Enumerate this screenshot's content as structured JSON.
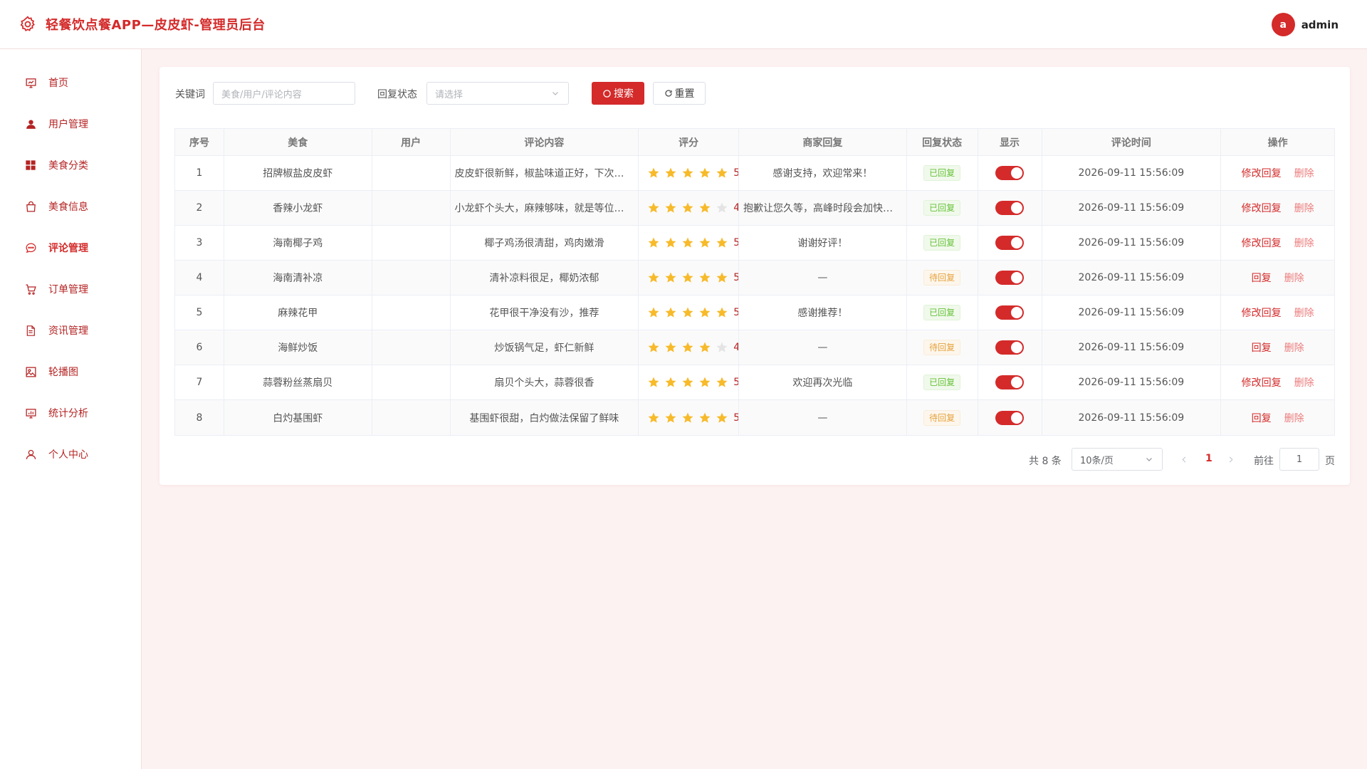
{
  "header": {
    "app_title": "轻餐饮点餐APP—皮皮虾-管理员后台",
    "avatar_letter": "a",
    "username": "admin",
    "accent_color": "#d42a2a"
  },
  "sidebar": {
    "items": [
      {
        "label": "首页",
        "icon": "dashboard-chart-icon"
      },
      {
        "label": "用户管理",
        "icon": "user-icon"
      },
      {
        "label": "美食分类",
        "icon": "grid-icon"
      },
      {
        "label": "美食信息",
        "icon": "shopping-bag-icon"
      },
      {
        "label": "评论管理",
        "icon": "chat-bubble-icon",
        "active": true
      },
      {
        "label": "订单管理",
        "icon": "cart-icon"
      },
      {
        "label": "资讯管理",
        "icon": "document-icon"
      },
      {
        "label": "轮播图",
        "icon": "image-icon"
      },
      {
        "label": "统计分析",
        "icon": "chart-icon"
      },
      {
        "label": "个人中心",
        "icon": "user-outline-icon"
      }
    ]
  },
  "filters": {
    "keyword_label": "关键词",
    "keyword_placeholder": "美食/用户/评论内容",
    "status_label": "回复状态",
    "status_placeholder": "请选择",
    "search_label": "搜索",
    "reset_label": "重置"
  },
  "table": {
    "headers": [
      "序号",
      "美食",
      "用户",
      "评论内容",
      "评分",
      "商家回复",
      "回复状态",
      "显示",
      "评论时间",
      "操作"
    ],
    "rows": [
      {
        "no": "1",
        "food": "招牌椒盐皮皮虾",
        "user": "",
        "comment": "皮皮虾很新鲜，椒盐味道正好，下次还来",
        "rating": 5,
        "rating_text": "5",
        "reply": "感谢支持，欢迎常来！",
        "status": "已回复",
        "replied": true,
        "visible": true,
        "time": "2026-09-11 15:56:09",
        "op_reply": "修改回复",
        "op_delete": "删除"
      },
      {
        "no": "2",
        "food": "香辣小龙虾",
        "user": "",
        "comment": "小龙虾个头大，麻辣够味，就是等位时间久",
        "rating": 4,
        "rating_text": "4",
        "reply": "抱歉让您久等，高峰时段会加快出餐",
        "status": "已回复",
        "replied": true,
        "visible": true,
        "time": "2026-09-11 15:56:09",
        "op_reply": "修改回复",
        "op_delete": "删除"
      },
      {
        "no": "3",
        "food": "海南椰子鸡",
        "user": "",
        "comment": "椰子鸡汤很清甜，鸡肉嫩滑",
        "rating": 5,
        "rating_text": "5",
        "reply": "谢谢好评！",
        "status": "已回复",
        "replied": true,
        "visible": true,
        "time": "2026-09-11 15:56:09",
        "op_reply": "修改回复",
        "op_delete": "删除"
      },
      {
        "no": "4",
        "food": "海南清补凉",
        "user": "",
        "comment": "清补凉料很足，椰奶浓郁",
        "rating": 5,
        "rating_text": "5",
        "reply": "—",
        "status": "待回复",
        "replied": false,
        "visible": true,
        "time": "2026-09-11 15:56:09",
        "op_reply": "回复",
        "op_delete": "删除"
      },
      {
        "no": "5",
        "food": "麻辣花甲",
        "user": "",
        "comment": "花甲很干净没有沙，推荐",
        "rating": 5,
        "rating_text": "5",
        "reply": "感谢推荐！",
        "status": "已回复",
        "replied": true,
        "visible": true,
        "time": "2026-09-11 15:56:09",
        "op_reply": "修改回复",
        "op_delete": "删除"
      },
      {
        "no": "6",
        "food": "海鲜炒饭",
        "user": "",
        "comment": "炒饭锅气足，虾仁新鲜",
        "rating": 4,
        "rating_text": "4",
        "reply": "—",
        "status": "待回复",
        "replied": false,
        "visible": true,
        "time": "2026-09-11 15:56:09",
        "op_reply": "回复",
        "op_delete": "删除"
      },
      {
        "no": "7",
        "food": "蒜蓉粉丝蒸扇贝",
        "user": "",
        "comment": "扇贝个头大，蒜蓉很香",
        "rating": 5,
        "rating_text": "5",
        "reply": "欢迎再次光临",
        "status": "已回复",
        "replied": true,
        "visible": true,
        "time": "2026-09-11 15:56:09",
        "op_reply": "修改回复",
        "op_delete": "删除"
      },
      {
        "no": "8",
        "food": "白灼基围虾",
        "user": "",
        "comment": "基围虾很甜，白灼做法保留了鲜味",
        "rating": 5,
        "rating_text": "5",
        "reply": "—",
        "status": "待回复",
        "replied": false,
        "visible": true,
        "time": "2026-09-11 15:56:09",
        "op_reply": "回复",
        "op_delete": "删除"
      }
    ]
  },
  "pagination": {
    "total_text": "共 8 条",
    "page_size": "10条/页",
    "current_page": "1",
    "goto_label": "前往",
    "goto_value": "1",
    "page_suffix": "页"
  },
  "colors": {
    "star": "#f7ba2a",
    "star_empty": "#e4e4e4"
  }
}
